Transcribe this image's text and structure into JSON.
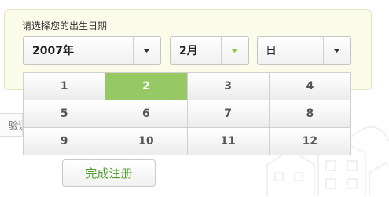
{
  "prompt": "请选择您的出生日期",
  "year_select": {
    "value": "2007年",
    "arrow_icon": "caret-down-icon"
  },
  "month_select": {
    "value": "2月",
    "arrow_icon": "caret-down-icon",
    "arrow_color": "#8cc63f"
  },
  "day_select": {
    "value": "日",
    "arrow_icon": "caret-down-icon"
  },
  "month_options": [
    "1",
    "2",
    "3",
    "4",
    "5",
    "6",
    "7",
    "8",
    "9",
    "10",
    "11",
    "12"
  ],
  "selected_month": "2",
  "verify_label": "验证",
  "submit_label": "完成注册",
  "colors": {
    "selected_bg": "#96c964",
    "submit_text": "#4f9e2d",
    "panel_bg": "#fbfbe9"
  }
}
